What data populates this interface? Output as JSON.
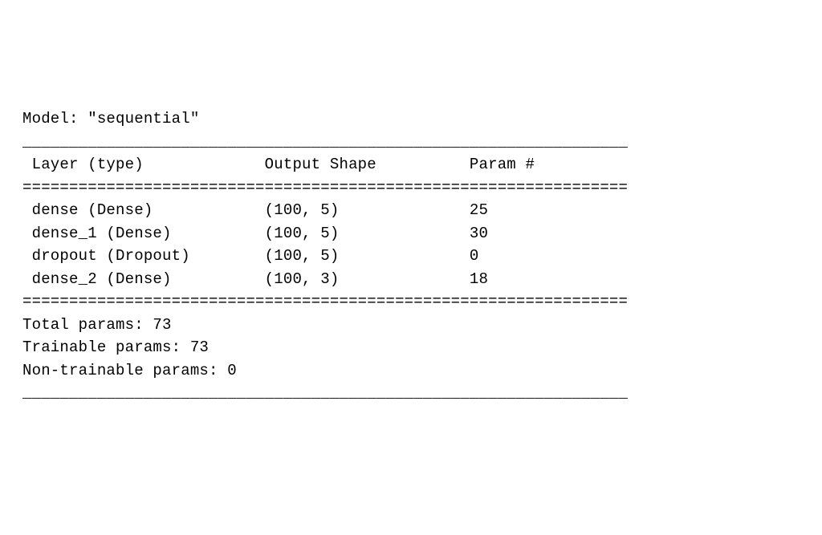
{
  "model_label": "Model:",
  "model_name": "\"sequential\"",
  "header": {
    "col1": "Layer (type)",
    "col2": "Output Shape",
    "col3": "Param #"
  },
  "layers": [
    {
      "name": "dense (Dense)",
      "output_shape": "(100, 5)",
      "params": "25"
    },
    {
      "name": "dense_1 (Dense)",
      "output_shape": "(100, 5)",
      "params": "30"
    },
    {
      "name": "dropout (Dropout)",
      "output_shape": "(100, 5)",
      "params": "0"
    },
    {
      "name": "dense_2 (Dense)",
      "output_shape": "(100, 3)",
      "params": "18"
    }
  ],
  "summary": {
    "total_label": "Total params:",
    "total_value": "73",
    "trainable_label": "Trainable params:",
    "trainable_value": "73",
    "nontrainable_label": "Non-trainable params:",
    "nontrainable_value": "0"
  },
  "chart_data": {
    "type": "table",
    "title": "Model: \"sequential\"",
    "columns": [
      "Layer (type)",
      "Output Shape",
      "Param #"
    ],
    "rows": [
      [
        "dense (Dense)",
        "(100, 5)",
        25
      ],
      [
        "dense_1 (Dense)",
        "(100, 5)",
        30
      ],
      [
        "dropout (Dropout)",
        "(100, 5)",
        0
      ],
      [
        "dense_2 (Dense)",
        "(100, 3)",
        18
      ]
    ],
    "totals": {
      "Total params": 73,
      "Trainable params": 73,
      "Non-trainable params": 0
    }
  }
}
